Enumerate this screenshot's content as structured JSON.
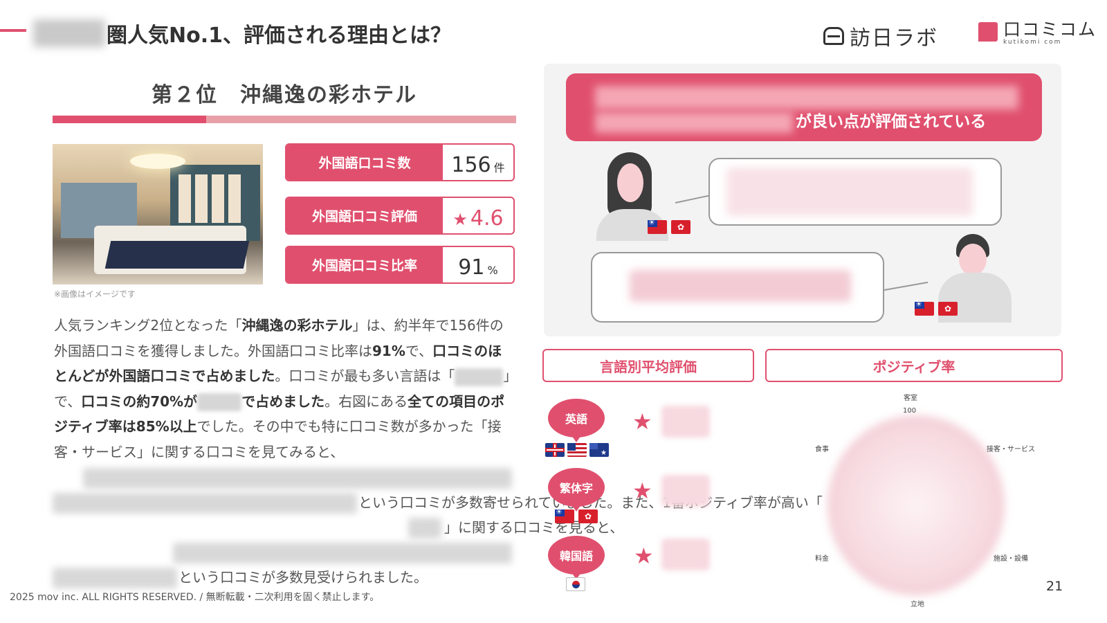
{
  "header": {
    "title": "圏人気No.1、評価される理由とは？",
    "logo_inbound": "訪日ラボ",
    "logo_kutikomi": "口コミコム",
    "logo_kutikomi_sub": "kutikomi com"
  },
  "ranking": {
    "title": "第２位　沖縄逸の彩ホテル",
    "image_note": "※画像はイメージです",
    "stats": [
      {
        "label": "外国語口コミ数",
        "value": "156",
        "unit": "件"
      },
      {
        "label": "外国語口コミ評価",
        "star": "★",
        "value": "4.6",
        "unit": ""
      },
      {
        "label": "外国語口コミ比率",
        "value": "91",
        "unit": "%"
      }
    ]
  },
  "body": {
    "p1a": "人気ランキング2位となった「",
    "p1b": "沖縄逸の彩ホテル",
    "p1c": "」は、約半年で156件の外国語口コミを獲得しました。外国語口コミ比率は",
    "p1d": "91%",
    "p1e": "で、",
    "p1f": "口コミのほとんどが外国語口コミで占めました",
    "p1g": "。口コミが最も多い言語は「",
    "p1h": "」で、",
    "p1i": "口コミの約70%が",
    "p1j": "で占めました",
    "p1k": "。右図にある",
    "p1l": "全ての項目のポジティブ率は85%以上",
    "p1m": "でした。その中でも特に口コミ数が多かった「接客・サービス」に関する口コミを見てみると、",
    "p2": "という口コミが多数寄せられていました。また、1番ポジティブ率が高い「",
    "p3": "」に関する口コミを見ると、",
    "p4": "という口コミが多数見受けられました。"
  },
  "right_panel": {
    "banner_text": "が良い点が評価されている"
  },
  "tabs": {
    "avg_rating": "言語別平均評価",
    "positive_rate": "ポジティブ率"
  },
  "languages": [
    {
      "label": "英語",
      "star": "★"
    },
    {
      "label": "繁体字",
      "star": "★"
    },
    {
      "label": "韓国語",
      "star": "★"
    }
  ],
  "radar": {
    "top": "客室",
    "top_value": "100",
    "left_upper": "食事",
    "right_upper": "接客・サービス",
    "left_lower": "料金",
    "right_lower": "施設・設備",
    "bottom": "立地"
  },
  "footer": {
    "copyright": "2025 mov inc. ALL RIGHTS RESERVED. / 無断転載・二次利用を固く禁止します。",
    "page_number": "21"
  },
  "colors": {
    "accent": "#e0506e",
    "accent_light": "#e8a0a8",
    "panel_bg": "#f3f3f4"
  },
  "icons": [
    "inbound-lab-logo-icon",
    "kutikomi-logo-icon",
    "star-icon",
    "flag-taiwan-icon",
    "flag-hongkong-icon",
    "flag-uk-icon",
    "flag-us-icon",
    "flag-australia-icon",
    "flag-korea-icon",
    "woman-avatar-icon",
    "man-avatar-icon"
  ]
}
